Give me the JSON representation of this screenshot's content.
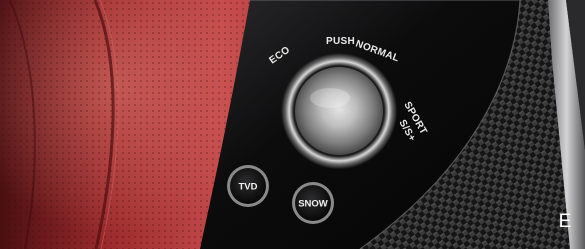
{
  "labels": {
    "eco": "ECO",
    "push": "PUSH",
    "normal": "NORMAL",
    "sport": "SPORT",
    "sport_plus": "S/S+"
  },
  "buttons": {
    "tvd": "TVD",
    "snow": "SNOW"
  },
  "corner_letter": "E"
}
